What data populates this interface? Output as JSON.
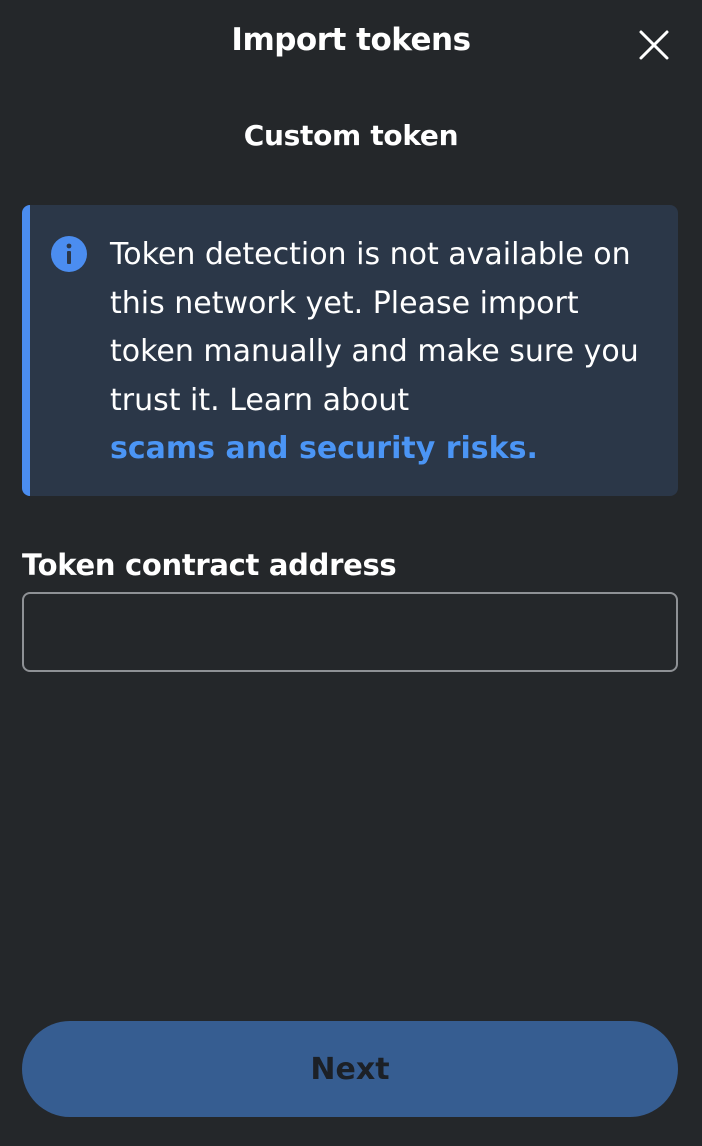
{
  "header": {
    "title": "Import tokens",
    "close_icon": "close-icon"
  },
  "tab": {
    "label": "Custom token"
  },
  "banner": {
    "icon": "info-icon",
    "text": "Token detection is not available on this network yet. Please import token manually and make sure you trust it. Learn about",
    "link_label": "scams and security risks.",
    "accent_color": "#4b8df0",
    "background_color": "#2b3748"
  },
  "form": {
    "address_label": "Token contract address",
    "address_value": "",
    "address_placeholder": ""
  },
  "footer": {
    "next_label": "Next",
    "next_color": "#365d91"
  },
  "theme": {
    "background": "#24272a",
    "text": "#ffffff",
    "link": "#4b95f5"
  }
}
